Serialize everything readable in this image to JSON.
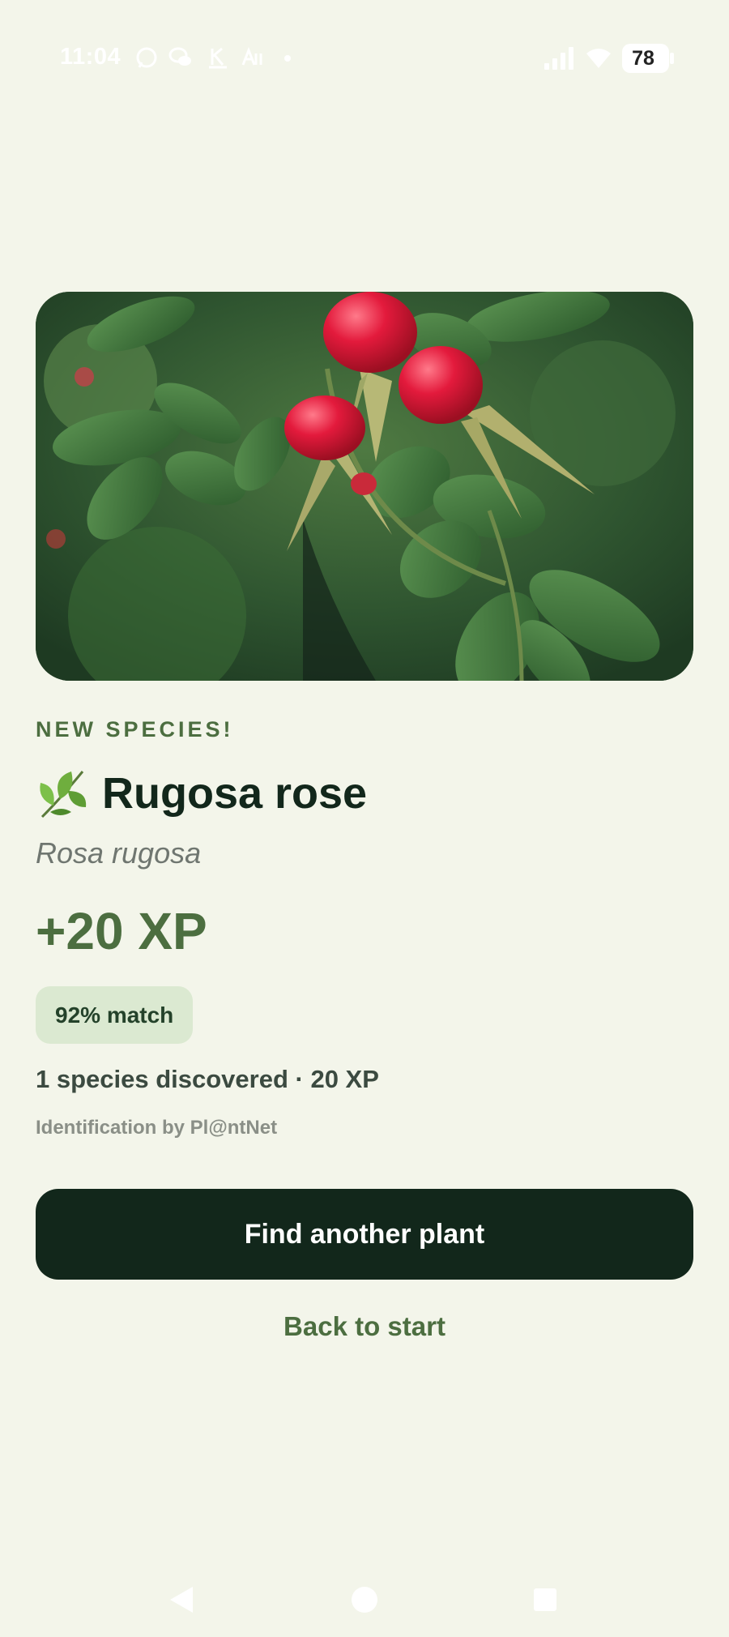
{
  "status_bar": {
    "time": "11:04",
    "notification_icons": [
      "whatsapp-icon",
      "wechat-icon",
      "k-app-icon",
      "a-app-icon"
    ],
    "battery": "78"
  },
  "result": {
    "photo_subject": "rose-hips-photo",
    "eyebrow": "NEW SPECIES!",
    "common_name": "Rugosa rose",
    "scientific_name": "Rosa rugosa",
    "xp_gain": "+20 XP",
    "match": "92% match",
    "summary": "1 species discovered · 20 XP",
    "attribution": "Identification by Pl@ntNet"
  },
  "actions": {
    "primary": "Find another plant",
    "secondary": "Back to start"
  },
  "colors": {
    "background": "#f3f5ea",
    "accent": "#4c6e40",
    "dark": "#12271b",
    "badge": "#dbe9d1"
  }
}
